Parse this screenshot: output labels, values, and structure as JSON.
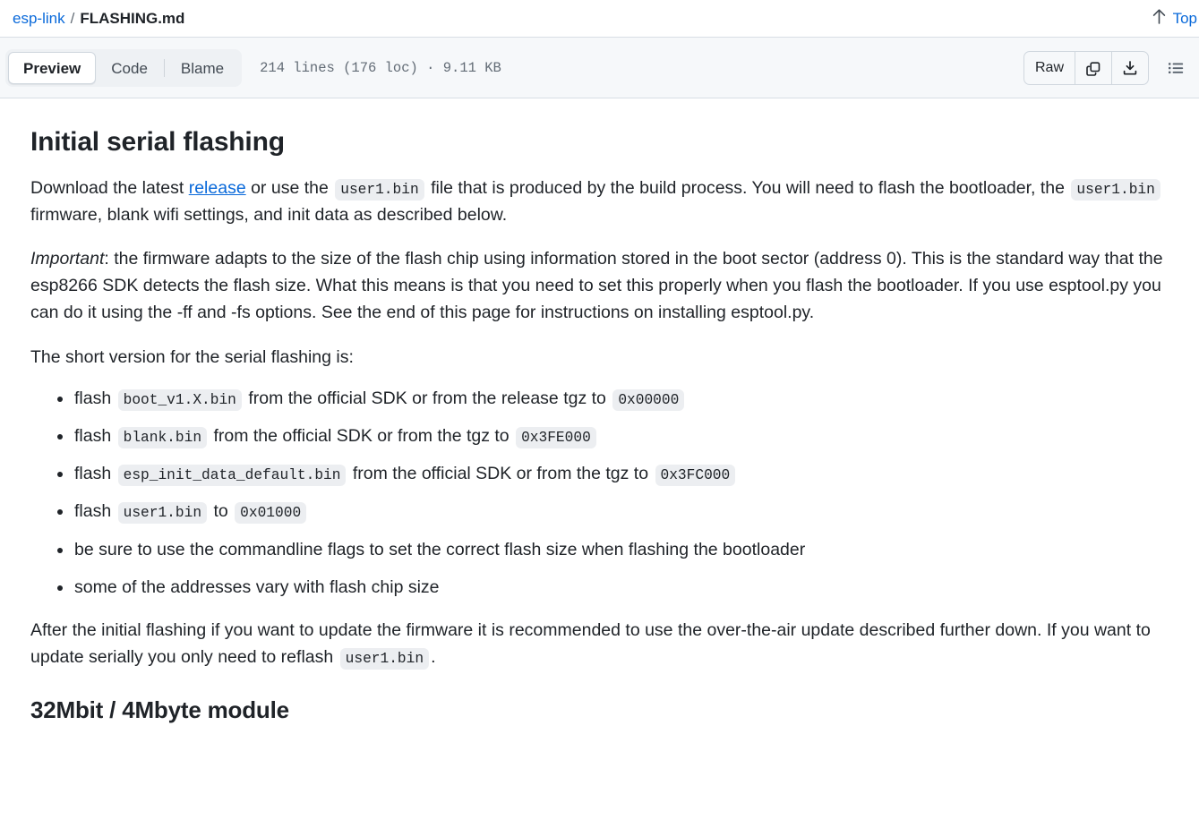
{
  "breadcrumb": {
    "repo": "esp-link",
    "separator": "/",
    "file": "FLASHING.md",
    "top_label": "Top",
    "top_icon": "arrow-up-icon"
  },
  "toolbar": {
    "tabs": [
      {
        "label": "Preview",
        "active": true
      },
      {
        "label": "Code",
        "active": false
      },
      {
        "label": "Blame",
        "active": false
      }
    ],
    "file_meta": "214 lines (176 loc) · 9.11 KB",
    "raw_label": "Raw",
    "copy_icon": "copy-icon",
    "download_icon": "download-icon",
    "outline_icon": "list-outline-icon"
  },
  "content": {
    "heading_1": "Initial serial flashing",
    "p1": {
      "part1": "Download the latest ",
      "link": "release",
      "part2": " or use the ",
      "code1": "user1.bin",
      "part3": " file that is produced by the build process. You will need to flash the bootloader, the ",
      "code2": "user1.bin",
      "part4": " firmware, blank wifi settings, and init data as described below."
    },
    "p2": {
      "emphasis": "Important",
      "text": ": the firmware adapts to the size of the flash chip using information stored in the boot sector (address 0). This is the standard way that the esp8266 SDK detects the flash size. What this means is that you need to set this properly when you flash the bootloader. If you use esptool.py you can do it using the -ff and -fs options. See the end of this page for instructions on installing esptool.py."
    },
    "p3": "The short version for the serial flashing is:",
    "bullets": [
      {
        "part1": "flash ",
        "code1": "boot_v1.X.bin",
        "part2": " from the official SDK or from the release tgz to ",
        "code2": "0x00000",
        "part3": ""
      },
      {
        "part1": "flash ",
        "code1": "blank.bin",
        "part2": " from the official SDK or from the tgz to ",
        "code2": "0x3FE000",
        "part3": ""
      },
      {
        "part1": "flash ",
        "code1": "esp_init_data_default.bin",
        "part2": " from the official SDK or from the tgz to ",
        "code2": "0x3FC000",
        "part3": ""
      },
      {
        "part1": "flash ",
        "code1": "user1.bin",
        "part2": " to ",
        "code2": "0x01000",
        "part3": ""
      },
      {
        "part1": "be sure to use the commandline flags to set the correct flash size when flashing the bootloader",
        "code1": "",
        "part2": "",
        "code2": "",
        "part3": ""
      },
      {
        "part1": "some of the addresses vary with flash chip size",
        "code1": "",
        "part2": "",
        "code2": "",
        "part3": ""
      }
    ],
    "p4": {
      "part1": "After the initial flashing if you want to update the firmware it is recommended to use the over-the-air update described further down. If you want to update serially you only need to reflash ",
      "code1": "user1.bin",
      "part2": "."
    },
    "heading_2": "32Mbit / 4Mbyte module"
  },
  "colors": {
    "link": "#0969da",
    "toolbar_bg": "#f6f8fa",
    "code_bg": "#eceef1",
    "border": "#d0d7de",
    "text": "#1f2328",
    "muted": "#636c76"
  }
}
